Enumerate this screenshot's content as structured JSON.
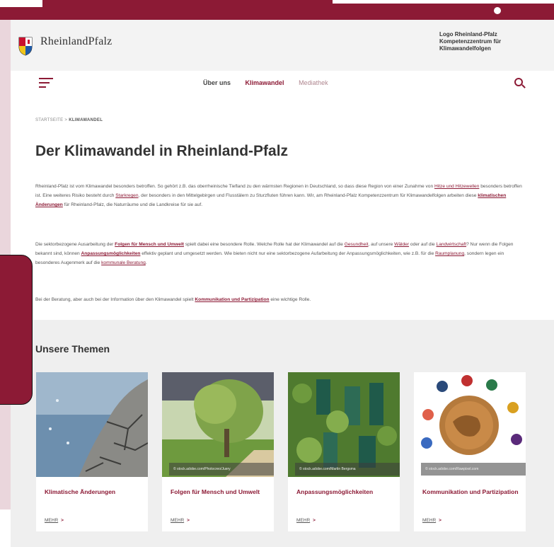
{
  "header": {
    "brand": "RheinlandPfalz",
    "logo_text": "Logo Rheinland-Pfalz Kompetenzzentrum für Klimawandelfolgen"
  },
  "nav": {
    "links": [
      "Über uns",
      "Klimawandel",
      "Mediathek"
    ]
  },
  "breadcrumb": {
    "home": "STARTSEITE",
    "sep": ">",
    "current": "KLIMAWANDEL"
  },
  "page": {
    "title": "Der Klimawandel in Rheinland-Pfalz"
  },
  "para1": {
    "t1": "Rheinland-Pfalz ist vom Klimawandel besonders betroffen. So gehört z.B. das oberrheinische Tiefland zu den wärmsten Regionen in Deutschland, so dass diese Region von einer Zunahme von ",
    "l1": "Hitze und Hitzewellen",
    "t2": " besonders betroffen ist. Eine weiteres Risiko besteht durch ",
    "l2": "Starkregen",
    "t3": ", der besonders in den Mittelgebirgen und Flusstälern zu Sturzfluten führen kann. Wir, am Rheinland-Pfalz Kompetenzzentrum für Klimawandelfolgen arbeiten diese ",
    "l3": "klimatischen Änderungen",
    "t4": " für Rheinland-Pfalz, die Naturräume und die Landkreise für sie auf."
  },
  "para2": {
    "t1": "Die sektorbezogene Ausarbeitung der ",
    "l1": "Folgen für Mensch und Umwelt",
    "t2": " spielt dabei eine besondere Rolle. Welche Rolle hat der Klimawandel auf die ",
    "l2": "Gesundheit",
    "t3": ", auf unsere ",
    "l3": "Wälder",
    "t4": " oder auf die ",
    "l4": "Landwirtschaft",
    "t5": "? Nur wenn die Folgen bekannt sind, können ",
    "l5": "Anpassungsmöglichkeiten",
    "t6": " effektiv geplant und umgesetzt werden. Wie bieten nicht nur eine sektorbezogene Aufarbeitung der Anpassungsmöglichkeiten, wie z.B. für die ",
    "l6": "Raumplanung",
    "t7": ", sondern legen ein besonderes Augenmerk auf die ",
    "l7": "kommunale Beratung",
    "t8": "."
  },
  "para3": {
    "t1": "Bei der Beratung, aber auch bei der Information über den Klimawandel spielt ",
    "l1": "Kommunikation und Partizipation",
    "t2": " eine wichtige Rolle."
  },
  "themes": {
    "title": "Unsere Themen",
    "cards": [
      {
        "title": "Klimatische Änderungen",
        "credit": "",
        "more": "MEHR",
        "arrow": ">"
      },
      {
        "title": "Folgen für Mensch und Umwelt",
        "credit": "© stock.adobe.com/Photocreo/Juery",
        "more": "MEHR",
        "arrow": ">"
      },
      {
        "title": "Anpassungsmöglichkeiten",
        "credit": "© stock.adobe.com/Martin Bergsma",
        "more": "MEHR",
        "arrow": ">"
      },
      {
        "title": "Kommunikation und Partizipation",
        "credit": "© stock.adobe.com/Rawpixel.com",
        "more": "MEHR",
        "arrow": ">"
      }
    ]
  },
  "colors": {
    "brand": "#8c1a35",
    "header_bg": "#f3f3f3",
    "themes_bg": "#efefef"
  }
}
